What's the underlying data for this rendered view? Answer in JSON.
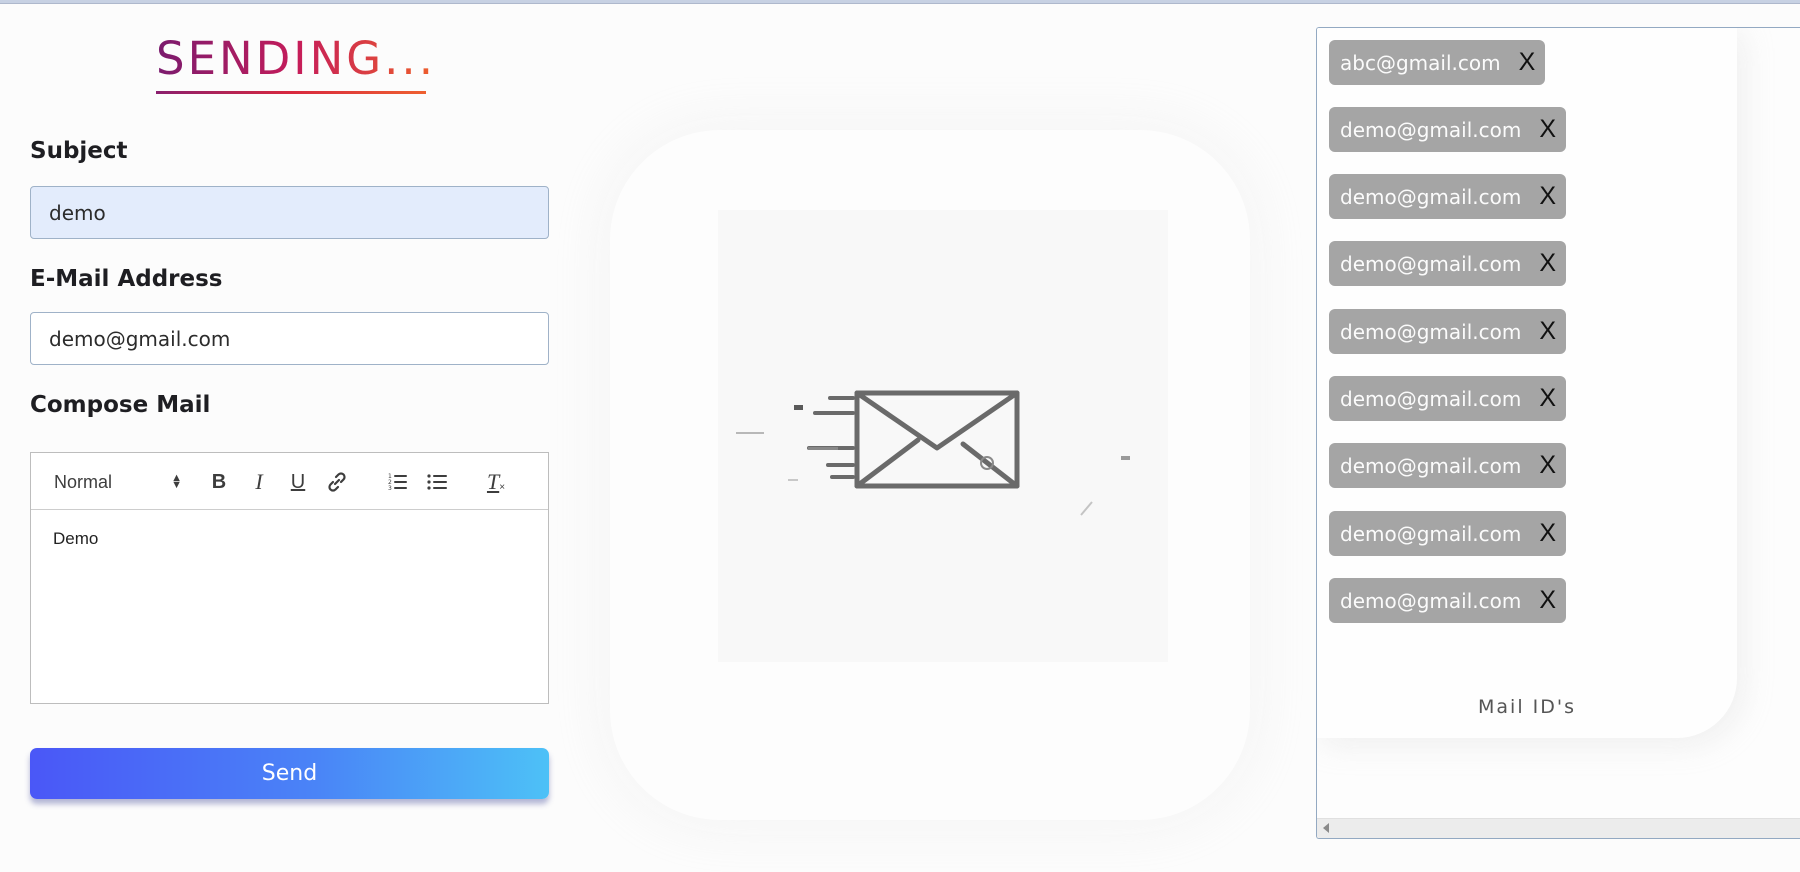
{
  "brand": {
    "title": "SENDING..."
  },
  "form": {
    "subject_label": "Subject",
    "subject_value": "demo",
    "email_label": "E-Mail Address",
    "email_value": "demo@gmail.com",
    "compose_label": "Compose Mail",
    "editor": {
      "format_select": "Normal",
      "toolbar_icons": [
        "bold-icon",
        "italic-icon",
        "underline-icon",
        "link-icon",
        "ordered-list-icon",
        "bullet-list-icon",
        "clear-format-icon"
      ],
      "bold_glyph": "B",
      "italic_glyph": "I",
      "underline_glyph": "U",
      "clear_glyph": "T",
      "body_text": "Demo"
    },
    "send_label": "Send"
  },
  "illustration": {
    "icon": "envelope-sending-icon"
  },
  "mail_list": {
    "remove_glyph": "X",
    "items": [
      "abc@gmail.com",
      "demo@gmail.com",
      "demo@gmail.com",
      "demo@gmail.com",
      "demo@gmail.com",
      "demo@gmail.com",
      "demo@gmail.com",
      "demo@gmail.com",
      "demo@gmail.com"
    ],
    "caption": "Mail ID's"
  },
  "colors": {
    "brand_gradient": [
      "#7a1b6e",
      "#c51c5a",
      "#ee5f2b"
    ],
    "send_gradient": [
      "#4a57f7",
      "#4dc1f7"
    ],
    "chip_bg": "#a5a5a5",
    "input_filled_bg": "#e3ecfc"
  }
}
